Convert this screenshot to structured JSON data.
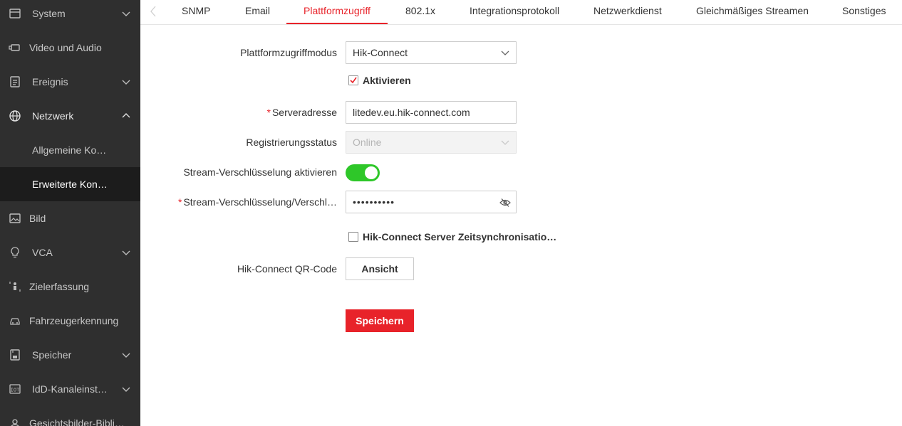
{
  "sidebar": {
    "items": [
      {
        "label": "System",
        "icon": "system-icon"
      },
      {
        "label": "Video und Audio",
        "icon": "video-audio-icon"
      },
      {
        "label": "Ereignis",
        "icon": "event-icon"
      },
      {
        "label": "Netzwerk",
        "icon": "globe-icon"
      },
      {
        "label": "Allgemeine Ko…"
      },
      {
        "label": "Erweiterte Kon…"
      },
      {
        "label": "Bild",
        "icon": "image-icon"
      },
      {
        "label": "VCA",
        "icon": "bulb-icon"
      },
      {
        "label": "Zielerfassung",
        "icon": "person-target-icon"
      },
      {
        "label": "Fahrzeugerkennung",
        "icon": "car-icon"
      },
      {
        "label": "Speicher",
        "icon": "storage-icon"
      },
      {
        "label": "IdD-Kanaleinst…",
        "icon": "iot-icon"
      },
      {
        "label": "Gesichtsbilder-Bibli…",
        "icon": "face-icon"
      }
    ]
  },
  "tabs": [
    "SNMP",
    "Email",
    "Plattformzugriff",
    "802.1x",
    "Integrationsprotokoll",
    "Netzwerkdienst",
    "Gleichmäßiges Streamen",
    "Sonstiges"
  ],
  "active_tab": "Plattformzugriff",
  "form": {
    "mode_label": "Plattformzugriffmodus",
    "mode_value": "Hik-Connect",
    "enable_label": "Aktivieren",
    "enable_checked": true,
    "server_label": "Serveradresse",
    "server_value": "litedev.eu.hik-connect.com",
    "reg_status_label": "Registrierungsstatus",
    "reg_status_value": "Online",
    "stream_enc_label": "Stream-Verschlüsselung aktivieren",
    "stream_enc_on": true,
    "stream_key_label": "Stream-Verschlüsselung/Verschl…",
    "stream_key_value": "••••••••••",
    "time_sync_label": "Hik-Connect Server Zeitsynchronisatio…",
    "time_sync_checked": false,
    "qr_label": "Hik-Connect QR-Code",
    "qr_button": "Ansicht",
    "save_button": "Speichern",
    "required_mark": "*"
  },
  "colors": {
    "accent": "#e8232a",
    "toggle_on": "#2ec729",
    "sidebar_bg": "#2f2f2f",
    "sidebar_active_bg": "#1c1c1c"
  }
}
